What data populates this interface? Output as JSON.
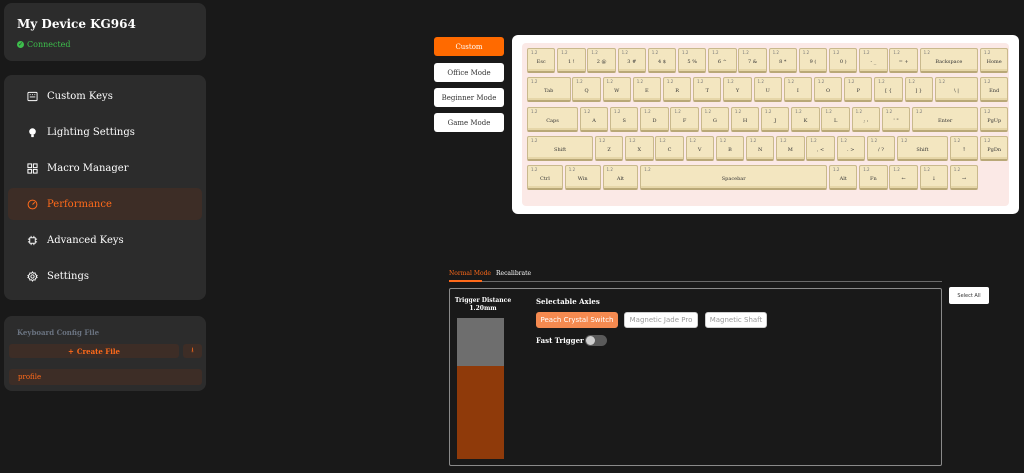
{
  "device": {
    "title": "My Device KG964",
    "status": "Connected",
    "status_color": "#3dbf4c"
  },
  "nav": [
    {
      "label": "Custom Keys",
      "icon": "keyboard-icon",
      "active": false
    },
    {
      "label": "Lighting Settings",
      "icon": "bulb-icon",
      "active": false
    },
    {
      "label": "Macro Manager",
      "icon": "macro-icon",
      "active": false
    },
    {
      "label": "Performance",
      "icon": "gauge-icon",
      "active": true
    },
    {
      "label": "Advanced Keys",
      "icon": "chip-icon",
      "active": false
    },
    {
      "label": "Settings",
      "icon": "gear-icon",
      "active": false
    }
  ],
  "config": {
    "title": "Keyboard Config File",
    "create_label": "Create File",
    "import_icon": "import-icon",
    "profiles": [
      "profile"
    ]
  },
  "modes": [
    {
      "label": "Custom",
      "active": true
    },
    {
      "label": "Office Mode",
      "active": false
    },
    {
      "label": "Beginner Mode",
      "active": false
    },
    {
      "label": "Game Mode",
      "active": false
    }
  ],
  "keyboard": {
    "rows": [
      [
        {
          "v": "1.2",
          "l": "Esc",
          "w": 1
        },
        {
          "v": "1.2",
          "l": "1 !",
          "w": 1
        },
        {
          "v": "1.2",
          "l": "2 @",
          "w": 1
        },
        {
          "v": "1.2",
          "l": "3 #",
          "w": 1
        },
        {
          "v": "1.2",
          "l": "4 $",
          "w": 1
        },
        {
          "v": "1.2",
          "l": "5 %",
          "w": 1
        },
        {
          "v": "1.2",
          "l": "6 ^",
          "w": 1
        },
        {
          "v": "1.2",
          "l": "7 &",
          "w": 1
        },
        {
          "v": "1.2",
          "l": "8 *",
          "w": 1
        },
        {
          "v": "1.2",
          "l": "9 (",
          "w": 1
        },
        {
          "v": "1.2",
          "l": "0 )",
          "w": 1
        },
        {
          "v": "1.2",
          "l": "- _",
          "w": 1
        },
        {
          "v": "1.2",
          "l": "= +",
          "w": 1
        },
        {
          "v": "1.2",
          "l": "Backspace",
          "w": 2
        },
        {
          "v": "1.2",
          "l": "Home",
          "w": 1
        }
      ],
      [
        {
          "v": "1.2",
          "l": "Tab",
          "w": 1.5
        },
        {
          "v": "1.2",
          "l": "Q",
          "w": 1
        },
        {
          "v": "1.2",
          "l": "W",
          "w": 1
        },
        {
          "v": "1.2",
          "l": "E",
          "w": 1
        },
        {
          "v": "1.2",
          "l": "R",
          "w": 1
        },
        {
          "v": "1.2",
          "l": "T",
          "w": 1
        },
        {
          "v": "1.2",
          "l": "Y",
          "w": 1
        },
        {
          "v": "1.2",
          "l": "U",
          "w": 1
        },
        {
          "v": "1.2",
          "l": "I",
          "w": 1
        },
        {
          "v": "1.2",
          "l": "O",
          "w": 1
        },
        {
          "v": "1.2",
          "l": "P",
          "w": 1
        },
        {
          "v": "1.2",
          "l": "[ {",
          "w": 1
        },
        {
          "v": "1.2",
          "l": "] }",
          "w": 1
        },
        {
          "v": "1.2",
          "l": "\\ |",
          "w": 1.5
        },
        {
          "v": "1.2",
          "l": "End",
          "w": 1
        }
      ],
      [
        {
          "v": "1.2",
          "l": "Caps",
          "w": 1.75
        },
        {
          "v": "1.2",
          "l": "A",
          "w": 1
        },
        {
          "v": "1.2",
          "l": "S",
          "w": 1
        },
        {
          "v": "1.2",
          "l": "D",
          "w": 1
        },
        {
          "v": "1.2",
          "l": "F",
          "w": 1
        },
        {
          "v": "1.2",
          "l": "G",
          "w": 1
        },
        {
          "v": "1.2",
          "l": "H",
          "w": 1
        },
        {
          "v": "1.2",
          "l": "J",
          "w": 1
        },
        {
          "v": "1.2",
          "l": "K",
          "w": 1
        },
        {
          "v": "1.2",
          "l": "L",
          "w": 1
        },
        {
          "v": "1.2",
          "l": "; :",
          "w": 1
        },
        {
          "v": "1.2",
          "l": "' \"",
          "w": 1
        },
        {
          "v": "1.2",
          "l": "Enter",
          "w": 2.25
        },
        {
          "v": "1.2",
          "l": "PgUp",
          "w": 1
        }
      ],
      [
        {
          "v": "1.2",
          "l": "Shift",
          "w": 2.25
        },
        {
          "v": "1.2",
          "l": "Z",
          "w": 1
        },
        {
          "v": "1.2",
          "l": "X",
          "w": 1
        },
        {
          "v": "1.2",
          "l": "C",
          "w": 1
        },
        {
          "v": "1.2",
          "l": "V",
          "w": 1
        },
        {
          "v": "1.2",
          "l": "B",
          "w": 1
        },
        {
          "v": "1.2",
          "l": "N",
          "w": 1
        },
        {
          "v": "1.2",
          "l": "M",
          "w": 1
        },
        {
          "v": "1.2",
          "l": ", <",
          "w": 1
        },
        {
          "v": "1.2",
          "l": ". >",
          "w": 1
        },
        {
          "v": "1.2",
          "l": "/ ?",
          "w": 1
        },
        {
          "v": "1.2",
          "l": "Shift",
          "w": 1.75
        },
        {
          "v": "1.2",
          "l": "↑",
          "w": 1
        },
        {
          "v": "1.2",
          "l": "PgDn",
          "w": 1
        }
      ],
      [
        {
          "v": "1.2",
          "l": "Ctrl",
          "w": 1.25
        },
        {
          "v": "1.2",
          "l": "Win",
          "w": 1.25
        },
        {
          "v": "1.2",
          "l": "Alt",
          "w": 1.25
        },
        {
          "v": "1.2",
          "l": "Spacebar",
          "w": 6.25
        },
        {
          "v": "1.2",
          "l": "Alt",
          "w": 1
        },
        {
          "v": "1.2",
          "l": "Fn",
          "w": 1
        },
        {
          "v": "1.2",
          "l": "←",
          "w": 1
        },
        {
          "v": "1.2",
          "l": "↓",
          "w": 1
        },
        {
          "v": "1.2",
          "l": "→",
          "w": 1
        }
      ]
    ]
  },
  "tabs": [
    {
      "label": "Normal Mode",
      "active": true
    },
    {
      "label": "Recalibrate",
      "active": false
    }
  ],
  "trigger": {
    "label": "Trigger Distance",
    "value": "1.20mm",
    "fill_fraction": 0.66
  },
  "axes": {
    "title": "Selectable Axles",
    "options": [
      {
        "label": "Peach Crystal Switch",
        "active": true
      },
      {
        "label": "Magnetic Jade Pro",
        "active": false
      },
      {
        "label": "Magnetic Shaft",
        "active": false
      }
    ]
  },
  "fast_trigger": {
    "label": "Fast Trigger",
    "enabled": false
  },
  "select_all": "Select All",
  "colors": {
    "accent": "#ff6a00",
    "panel": "#2c2c2c",
    "background": "#191919"
  }
}
